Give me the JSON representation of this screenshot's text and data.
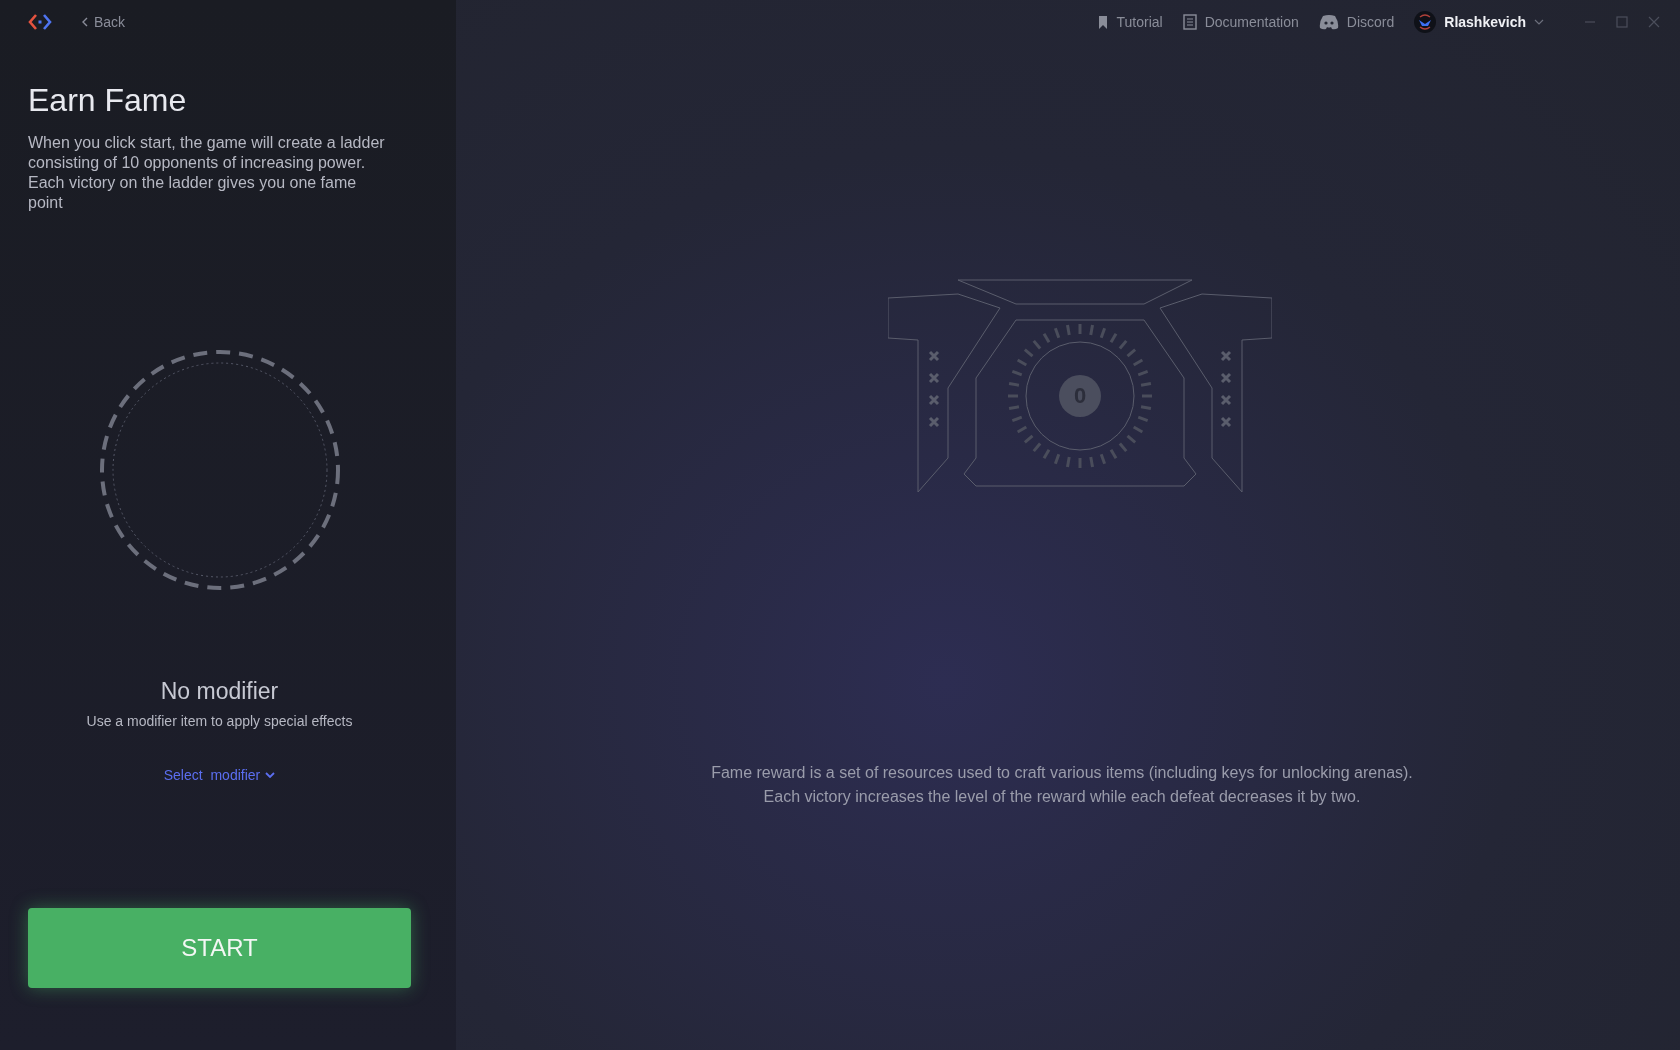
{
  "header": {
    "back": "Back",
    "links": [
      {
        "kind": "bookmark",
        "label": "Tutorial"
      },
      {
        "kind": "document",
        "label": "Documentation"
      },
      {
        "kind": "discord",
        "label": "Discord"
      }
    ],
    "user": "Rlashkevich"
  },
  "panel": {
    "title": "Earn Fame",
    "description": "When you click start, the game will create a ladder consisting of 10 opponents of increasing power. Each victory on the ladder gives you one fame point",
    "modifier_title": "No modifier",
    "modifier_hint": "Use a modifier item to apply special effects",
    "select_modifier": "Select  modifier",
    "start": "START"
  },
  "emblem": {
    "value": "0"
  },
  "reward_note": [
    "Fame reward is a set of resources used to craft various items (including keys for unlocking arenas).",
    "Each victory increases the level of the reward while each defeat decreases it by two."
  ]
}
